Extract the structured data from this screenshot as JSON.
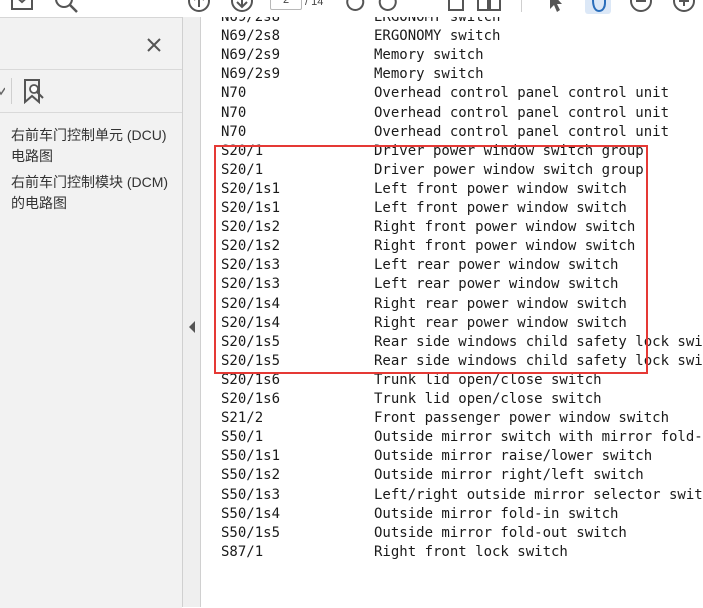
{
  "toolbar": {
    "icons": [
      "mail-icon",
      "zoom-out-icon",
      "page-up-icon",
      "page-down-icon",
      "rotate-left-icon",
      "rotate-right-icon",
      "single-page-icon",
      "two-page-icon",
      "select-cursor-icon",
      "hand-tool-icon",
      "zoom-minus-icon",
      "zoom-plus-icon"
    ],
    "current_page": "2",
    "total_pages": "/ 14"
  },
  "sidebar": {
    "close_label": "×",
    "items": [
      {
        "label": "右前车门控制单元 (DCU) 电路图"
      },
      {
        "label": "右前车门控制模块 (DCM) 的电路图"
      }
    ]
  },
  "document": {
    "rows": [
      {
        "code": "N69/2s8",
        "desc": "ERGONOMY switch"
      },
      {
        "code": "N69/2s8",
        "desc": "ERGONOMY switch"
      },
      {
        "code": "N69/2s9",
        "desc": "Memory switch"
      },
      {
        "code": "N69/2s9",
        "desc": "Memory switch"
      },
      {
        "code": "N70",
        "desc": "Overhead control panel control unit"
      },
      {
        "code": "N70",
        "desc": "Overhead control panel control unit"
      },
      {
        "code": "N70",
        "desc": "Overhead control panel control unit"
      },
      {
        "code": "S20/1",
        "desc": "Driver power window switch group"
      },
      {
        "code": "S20/1",
        "desc": "Driver power window switch group"
      },
      {
        "code": "S20/1s1",
        "desc": "Left front power window switch"
      },
      {
        "code": "S20/1s1",
        "desc": "Left front power window switch"
      },
      {
        "code": "S20/1s2",
        "desc": "Right front power window switch"
      },
      {
        "code": "S20/1s2",
        "desc": "Right front power window switch"
      },
      {
        "code": "S20/1s3",
        "desc": "Left rear power window switch"
      },
      {
        "code": "S20/1s3",
        "desc": "Left rear power window switch"
      },
      {
        "code": "S20/1s4",
        "desc": "Right rear power window switch"
      },
      {
        "code": "S20/1s4",
        "desc": "Right rear power window switch"
      },
      {
        "code": "S20/1s5",
        "desc": "Rear side windows child safety lock switch"
      },
      {
        "code": "S20/1s5",
        "desc": "Rear side windows child safety lock switch"
      },
      {
        "code": "S20/1s6",
        "desc": "Trunk lid open/close switch"
      },
      {
        "code": "S20/1s6",
        "desc": "Trunk lid open/close switch"
      },
      {
        "code": "S21/2",
        "desc": "Front passenger power window switch"
      },
      {
        "code": "S50/1",
        "desc": "Outside mirror switch with mirror fold-in/f"
      },
      {
        "code": "S50/1s1",
        "desc": "Outside mirror raise/lower switch"
      },
      {
        "code": "S50/1s2",
        "desc": "Outside mirror right/left switch"
      },
      {
        "code": "S50/1s3",
        "desc": "Left/right outside mirror selector switch"
      },
      {
        "code": "S50/1s4",
        "desc": "Outside mirror fold-in switch"
      },
      {
        "code": "S50/1s5",
        "desc": "Outside mirror fold-out switch"
      },
      {
        "code": "S87/1",
        "desc": "Right front lock switch"
      }
    ],
    "highlight_color": "#e53935"
  }
}
